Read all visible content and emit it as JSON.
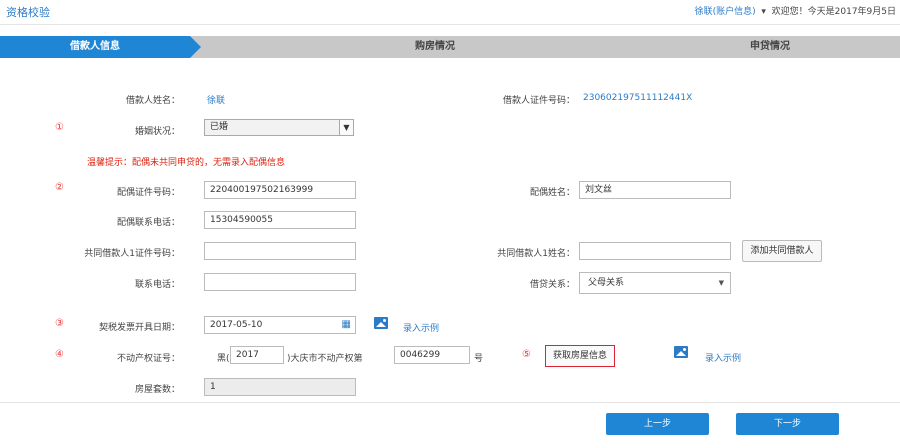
{
  "header": {
    "title": "资格校验",
    "user_link": "徐联(账户信息)",
    "welcome": "欢迎您！今天是2017年9月5日"
  },
  "steps": [
    "借款人信息",
    "购房情况",
    "申贷情况"
  ],
  "form": {
    "borrower_name_label": "借款人姓名：",
    "borrower_name_value": "徐联",
    "borrower_id_label": "借款人证件号码：",
    "borrower_id_value": "230602197511112441X",
    "marker_1": "①",
    "marital_label": "婚姻状况：",
    "marital_value": "已婚",
    "warning": "温馨提示：配偶未共同申贷的，无需录入配偶信息",
    "marker_2": "②",
    "spouse_id_label": "配偶证件号码：",
    "spouse_id_value": "220400197502163999",
    "spouse_name_label": "配偶姓名：",
    "spouse_name_value": "刘文丝",
    "spouse_phone_label": "配偶联系电话：",
    "spouse_phone_value": "15304590055",
    "co_id_label": "共同借款人1证件号码：",
    "co_name_label": "共同借款人1姓名：",
    "add_co_button": "添加共同借款人",
    "contact_label": "联系电话：",
    "relation_label": "借贷关系：",
    "relation_value": "父母关系",
    "marker_3": "③",
    "contract_date_label": "契税发票开具日期：",
    "contract_date_value": "2017-05-10",
    "example_link_1": "录入示例",
    "marker_4": "④",
    "property_label": "不动产权证号：",
    "property_prefix": "黑(",
    "property_year": "2017",
    "property_mid": ")大庆市不动产权第",
    "property_no": "0046299",
    "property_suffix": "号",
    "marker_5": "⑤",
    "fetch_button": "获取房屋信息",
    "example_link_2": "录入示例",
    "houses_label": "房屋套数：",
    "houses_value": "1"
  },
  "footer": {
    "prev_button": "上一步",
    "next_button": "下一步"
  }
}
